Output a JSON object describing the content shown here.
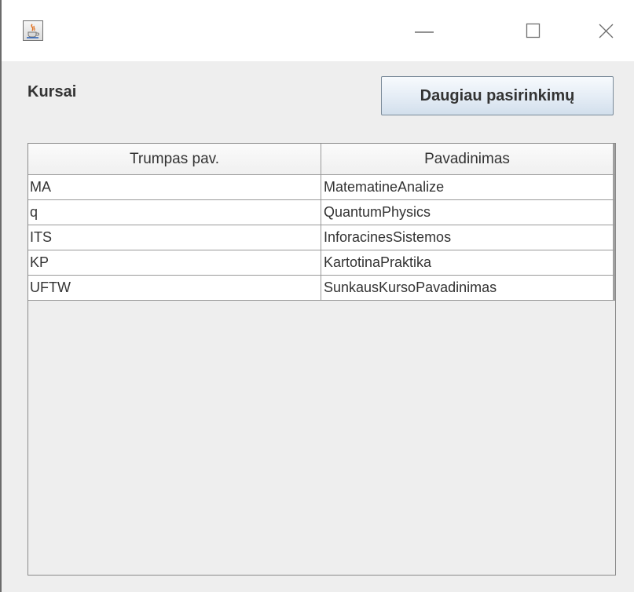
{
  "window": {
    "icon": "java-cup-icon",
    "controls": {
      "minimize_icon": "minimize-icon",
      "maximize_icon": "maximize-icon",
      "close_icon": "close-icon"
    }
  },
  "main": {
    "title": "Kursai",
    "more_button_label": "Daugiau pasirinkimų"
  },
  "table": {
    "columns": [
      "Trumpas pav.",
      "Pavadinimas"
    ],
    "rows": [
      [
        "MA",
        "MatematineAnalize"
      ],
      [
        "q",
        "QuantumPhysics"
      ],
      [
        "ITS",
        "InforacinesSistemos"
      ],
      [
        "KP",
        "KartotinaPraktika"
      ],
      [
        "UFTW",
        "SunkausKursoPavadinimas"
      ]
    ]
  }
}
